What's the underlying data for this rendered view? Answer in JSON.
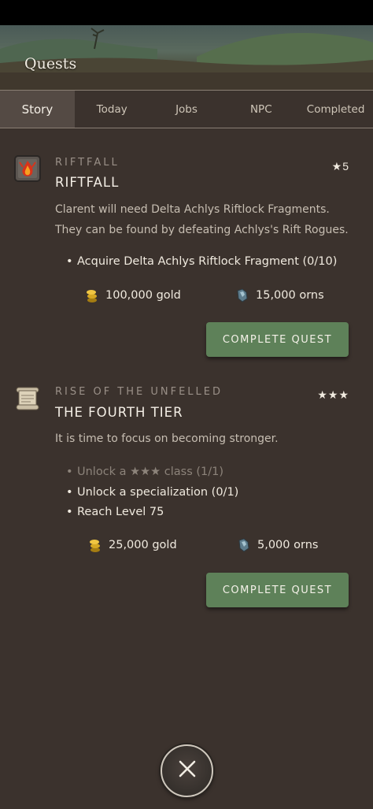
{
  "header": {
    "title": "Quests"
  },
  "tabs": [
    {
      "label": "Story",
      "active": true
    },
    {
      "label": "Today",
      "active": false
    },
    {
      "label": "Jobs",
      "active": false
    },
    {
      "label": "NPC",
      "active": false
    },
    {
      "label": "Completed",
      "active": false
    }
  ],
  "quests": [
    {
      "icon": "flame-rune-icon",
      "category": "RIFTFALL",
      "title": "RIFTFALL",
      "rating": "★5",
      "description_lines": [
        "Clarent will need Delta Achlys Riftlock Fragments.",
        "They can be found by defeating Achlys's Rift Rogues."
      ],
      "objectives": [
        {
          "text": "Acquire Delta Achlys Riftlock Fragment (0/10)",
          "done": false
        }
      ],
      "rewards": {
        "gold": "100,000 gold",
        "orns": "15,000 orns"
      },
      "button_label": "COMPLETE QUEST"
    },
    {
      "icon": "scroll-icon",
      "category": "RISE OF THE UNFELLED",
      "title": "THE FOURTH TIER",
      "rating": "★★★",
      "description_lines": [
        "It is time to focus on becoming stronger."
      ],
      "objectives": [
        {
          "text": "Unlock a ★★★ class (1/1)",
          "done": true
        },
        {
          "text": "Unlock a specialization (0/1)",
          "done": false
        },
        {
          "text": "Reach Level 75",
          "done": false
        }
      ],
      "rewards": {
        "gold": "25,000 gold",
        "orns": "5,000 orns"
      },
      "button_label": "COMPLETE QUEST"
    }
  ],
  "colors": {
    "background": "#3b322d",
    "active_tab": "#544a44",
    "button": "#5e8159",
    "muted_text": "#9a9088"
  }
}
